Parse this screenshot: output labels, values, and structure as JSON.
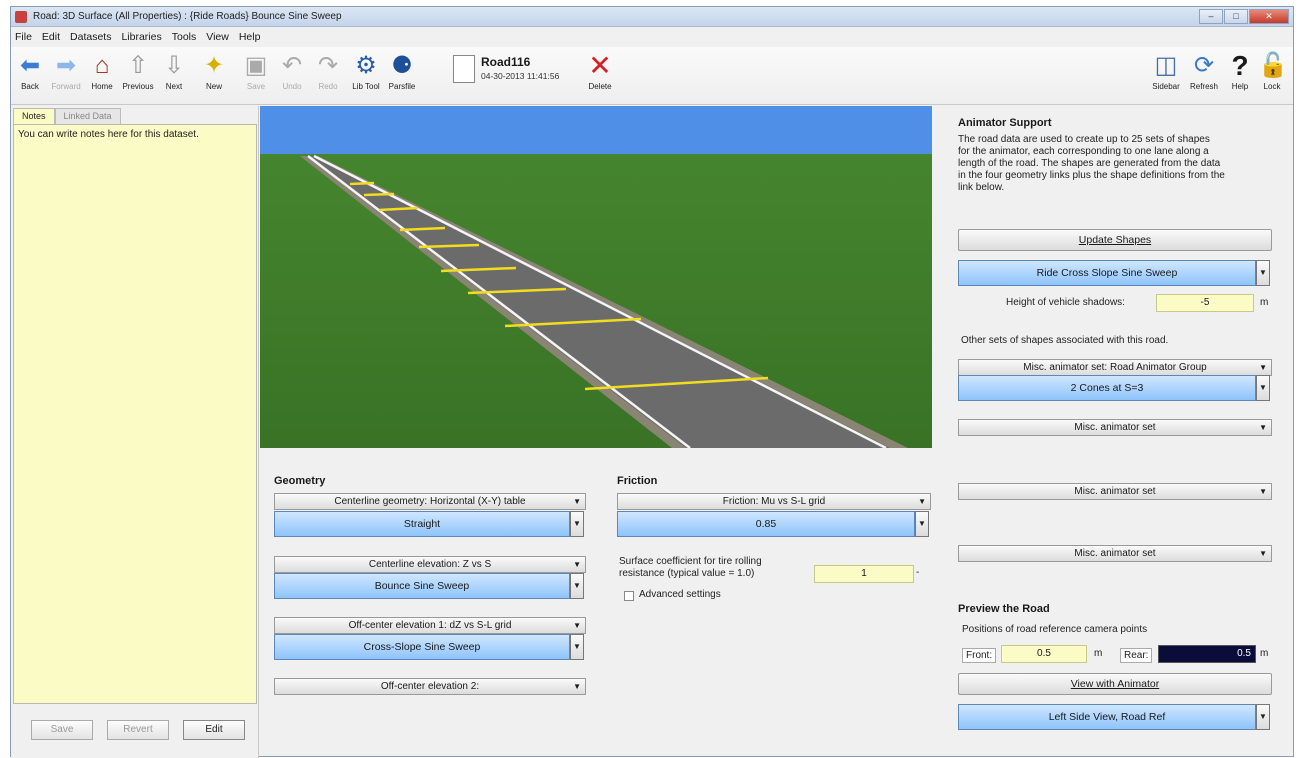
{
  "window": {
    "title": "Road: 3D Surface (All Properties) : {Ride Roads} Bounce Sine Sweep"
  },
  "menu": [
    "File",
    "Edit",
    "Datasets",
    "Libraries",
    "Tools",
    "View",
    "Help"
  ],
  "toolbar": {
    "back": "Back",
    "forward": "Forward",
    "home": "Home",
    "previous": "Previous",
    "next": "Next",
    "new": "New",
    "save": "Save",
    "undo": "Undo",
    "redo": "Redo",
    "libtool": "Lib Tool",
    "parsfile": "Parsfile",
    "delete": "Delete",
    "sidebar": "Sidebar",
    "refresh": "Refresh",
    "help": "Help",
    "lock": "Lock",
    "file_name": "Road116",
    "file_date": "04-30-2013 11:41:56"
  },
  "notes": {
    "tab_notes": "Notes",
    "tab_linked": "Linked Data",
    "text": "You can write notes here for this dataset.",
    "save": "Save",
    "revert": "Revert",
    "edit": "Edit"
  },
  "geometry": {
    "header": "Geometry",
    "centerline_link": "Centerline geometry: Horizontal (X-Y) table",
    "centerline_value": "Straight",
    "elev_link": "Centerline elevation: Z vs S",
    "elev_value": "Bounce Sine Sweep",
    "off1_link": "Off-center elevation 1: dZ vs S-L grid",
    "off1_value": "Cross-Slope Sine Sweep",
    "off2_link": "Off-center elevation 2:"
  },
  "friction": {
    "header": "Friction",
    "link": "Friction: Mu vs S-L grid",
    "value": "0.85",
    "surface_label_1": "Surface coefficient for tire rolling",
    "surface_label_2": "resistance (typical value = 1.0)",
    "surface_value": "1",
    "surface_unit": "-",
    "advanced": "Advanced settings"
  },
  "animator": {
    "header": "Animator Support",
    "desc_1": "The road data are used to create up to 25 sets of shapes",
    "desc_2": "for the animator, each corresponding to one lane along a",
    "desc_3": "length of the road. The shapes are generated from the data",
    "desc_4": "in the four geometry links plus the shape definitions from the",
    "desc_5": "link below.",
    "update_btn": "Update Shapes",
    "shape_value": "Ride Cross Slope Sine Sweep",
    "shadow_label": "Height of vehicle shadows:",
    "shadow_value": "-5",
    "shadow_unit": "m",
    "other_label": "Other sets of shapes associated with this road.",
    "misc1_link": "Misc. animator set: Road Animator Group",
    "misc1_value": "2 Cones at S=3",
    "misc2_link": "Misc. animator set",
    "misc3_link": "Misc. animator set",
    "misc4_link": "Misc. animator set"
  },
  "preview": {
    "header": "Preview the Road",
    "positions_label": "Positions of road reference camera points",
    "front_label": "Front:",
    "front_value": "0.5",
    "front_unit": "m",
    "rear_label": "Rear:",
    "rear_value": "0.5",
    "rear_unit": "m",
    "view_btn": "View with Animator",
    "view_value": "Left Side View, Road Ref"
  },
  "colors": {
    "sky": "#4f8fe8",
    "grass": "#3e7a2a",
    "asphalt": "#6d6d6d",
    "lane_yellow": "#f2dc1e",
    "notes_bg": "#fbfbc6",
    "blue_dropdown": "#8ec4fb"
  }
}
